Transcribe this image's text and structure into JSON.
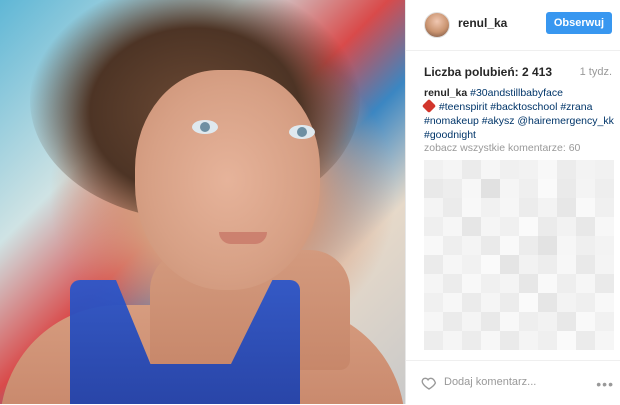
{
  "post": {
    "username": "renul_ka",
    "follow_label": "Obserwuj",
    "likes_text": "Liczba polubień: 2 413",
    "time_text": "1 tydz.",
    "caption": {
      "username": "renul_ka",
      "tags_line1": "#30andstillbabyface",
      "tags_line2": "#teenspirit #backtoschool #zrana",
      "tags_line3": "#nomakeup #akysz @hairemergency_kk",
      "tags_line4": "#goodnight"
    },
    "view_all_comments": "zobacz wszystkie komentarze: 60",
    "add_comment_placeholder": "Dodaj komentarz...",
    "more_glyph": "•••"
  },
  "icons": {
    "avatar": "avatar",
    "heart": "heart-icon",
    "more": "more-options-icon",
    "emoji": "warning-emoji-icon"
  },
  "colors": {
    "follow_button": "#3897f0",
    "hashtag": "#003569",
    "muted": "#999999",
    "text": "#262626"
  }
}
